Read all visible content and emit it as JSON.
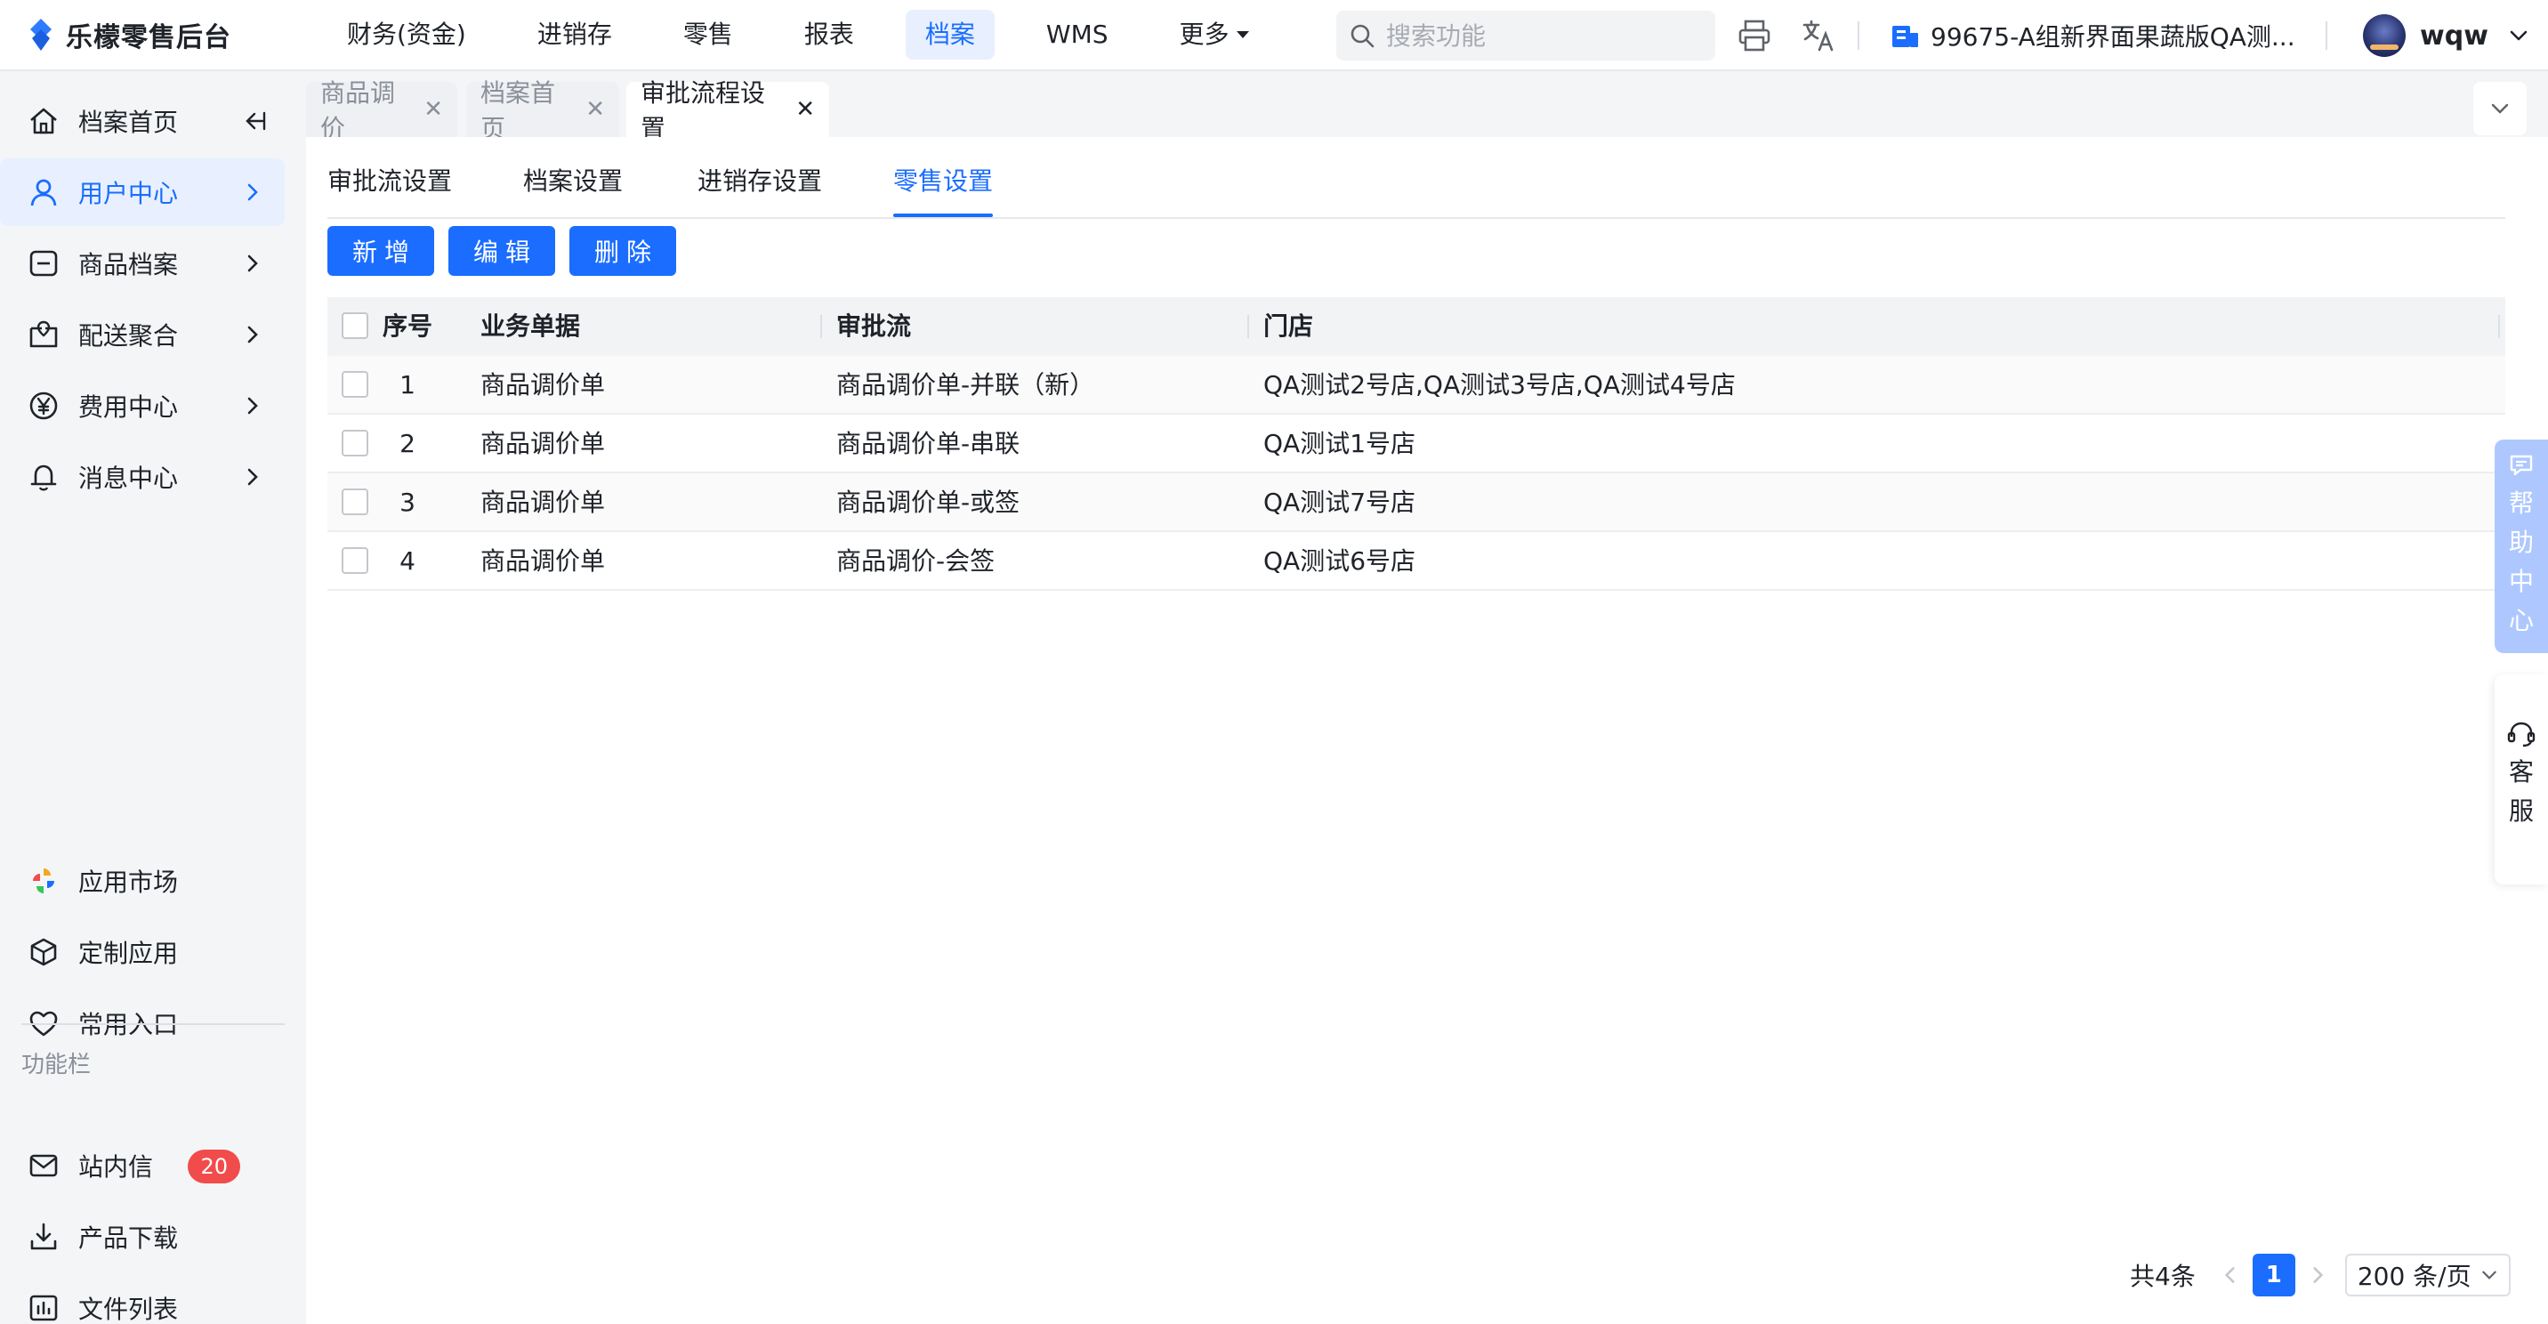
{
  "app": {
    "title": "乐檬零售后台"
  },
  "topnav": {
    "items": [
      {
        "label": "财务(资金)"
      },
      {
        "label": "进销存"
      },
      {
        "label": "零售"
      },
      {
        "label": "报表"
      },
      {
        "label": "档案",
        "active": true
      },
      {
        "label": "WMS"
      }
    ],
    "more_label": "更多"
  },
  "search": {
    "placeholder": "搜索功能"
  },
  "store": {
    "label": "99675-A组新界面果蔬版QA测..."
  },
  "user": {
    "name": "wqw"
  },
  "sidebar": {
    "items": [
      {
        "label": "档案首页",
        "icon": "home-icon"
      },
      {
        "label": "用户中心",
        "icon": "user-icon",
        "active": true
      },
      {
        "label": "商品档案",
        "icon": "product-icon"
      },
      {
        "label": "配送聚合",
        "icon": "delivery-icon"
      },
      {
        "label": "费用中心",
        "icon": "yen-icon"
      },
      {
        "label": "消息中心",
        "icon": "bell-icon"
      }
    ],
    "apps": [
      {
        "label": "应用市场",
        "icon": "app-market-icon"
      },
      {
        "label": "定制应用",
        "icon": "cube-icon"
      },
      {
        "label": "常用入口",
        "icon": "heart-icon"
      }
    ],
    "function_caption": "功能栏",
    "functions": [
      {
        "label": "站内信",
        "icon": "mail-icon",
        "badge": "20"
      },
      {
        "label": "产品下载",
        "icon": "download-icon"
      },
      {
        "label": "文件列表",
        "icon": "file-list-icon"
      }
    ]
  },
  "page_tabs": [
    {
      "label": "商品调价"
    },
    {
      "label": "档案首页"
    },
    {
      "label": "审批流程设置",
      "active": true
    }
  ],
  "sub_tabs": [
    {
      "label": "审批流设置"
    },
    {
      "label": "档案设置"
    },
    {
      "label": "进销存设置"
    },
    {
      "label": "零售设置",
      "active": true
    }
  ],
  "toolbar": {
    "add": "新增",
    "edit": "编辑",
    "delete": "删除"
  },
  "table": {
    "headers": {
      "no": "序号",
      "doc": "业务单据",
      "flow": "审批流",
      "store": "门店"
    },
    "rows": [
      {
        "no": "1",
        "doc": "商品调价单",
        "flow": "商品调价单-并联（新）",
        "store": "QA测试2号店,QA测试3号店,QA测试4号店"
      },
      {
        "no": "2",
        "doc": "商品调价单",
        "flow": "商品调价单-串联",
        "store": "QA测试1号店"
      },
      {
        "no": "3",
        "doc": "商品调价单",
        "flow": "商品调价单-或签",
        "store": "QA测试7号店"
      },
      {
        "no": "4",
        "doc": "商品调价单",
        "flow": "商品调价-会签",
        "store": "QA测试6号店"
      }
    ]
  },
  "pagination": {
    "total": "共4条",
    "current": "1",
    "page_size": "200 条/页"
  },
  "floating": {
    "help": [
      "帮",
      "助",
      "中",
      "心"
    ],
    "service": [
      "客",
      "服"
    ]
  },
  "colors": {
    "accent": "#1a6dff",
    "badge": "#f24b4b"
  }
}
